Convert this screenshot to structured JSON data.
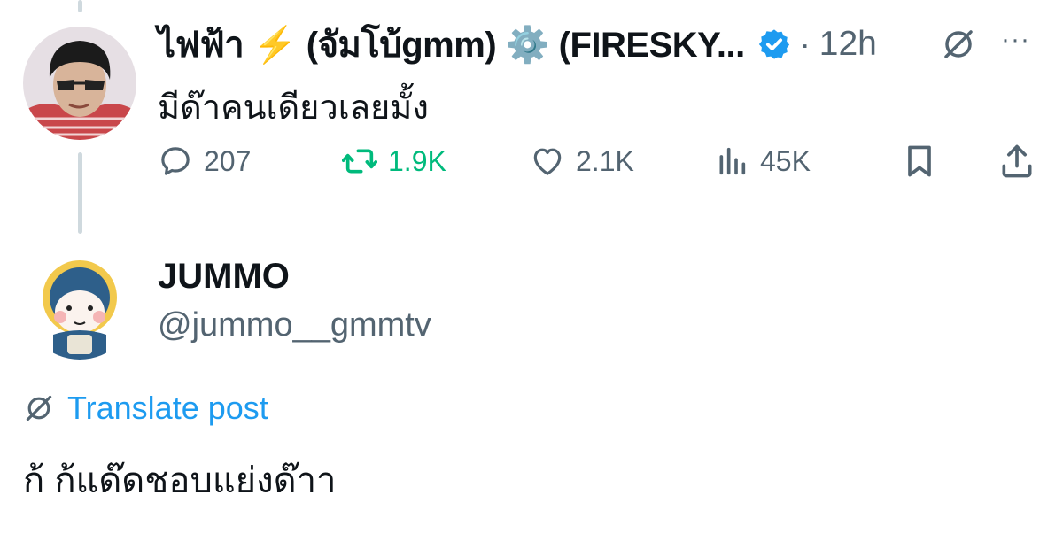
{
  "reply": {
    "display_name": "ไฟฟ้า ⚡️ (จัมโบ้gmm) ⚙️ (FIRESKY...",
    "time_separator": "·",
    "time": "12h",
    "text": "มีด๊าคนเดียวเลยมั้ง",
    "more_label": "···",
    "metrics": {
      "replies": "207",
      "reposts": "1.9K",
      "likes": "2.1K",
      "views": "45K"
    }
  },
  "quoted": {
    "display_name": "JUMMO",
    "handle": "@jummo__gmmtv",
    "translate_label": "Translate post",
    "text": "ก้ ก้แด๊ดชอบแย่งด๊าา"
  },
  "colors": {
    "accent": "#1d9bf0",
    "repost": "#00ba7c",
    "secondary_text": "#536471",
    "thread_line": "#cfd9de"
  },
  "icons": [
    "grok-icon",
    "more-icon",
    "reply-icon",
    "repost-icon",
    "like-icon",
    "views-icon",
    "bookmark-icon",
    "share-icon",
    "translate-icon",
    "verified-badge-icon"
  ]
}
